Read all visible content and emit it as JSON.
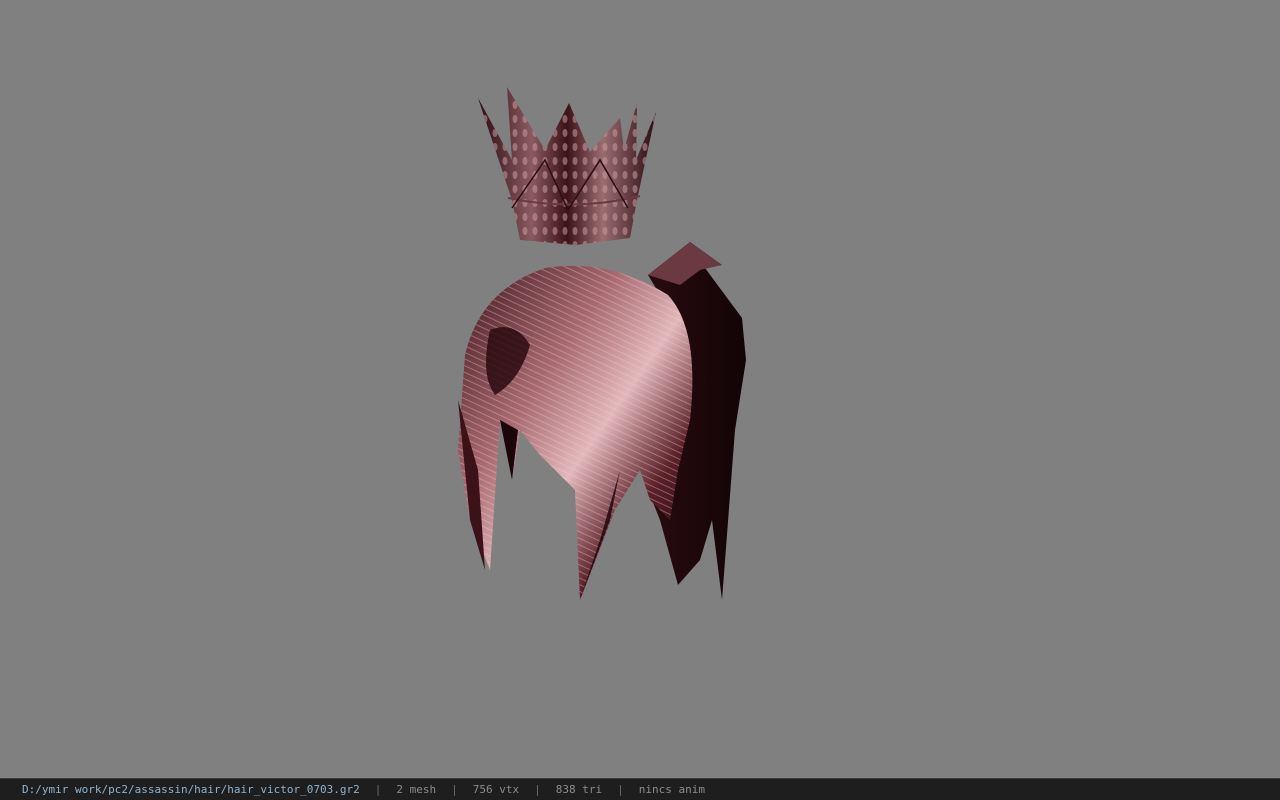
{
  "viewer": {
    "background_color": "#808080",
    "model_hint": "textured-hair-mesh-with-crown",
    "hair_dark_color": "#2a0d12",
    "hair_highlight_color": "#d9a6a9",
    "crown_color": "#5a2a30"
  },
  "statusbar": {
    "file_path": "D:/ymir work/pc2/assassin/hair/hair_victor_0703.gr2",
    "separator": "|",
    "mesh_count": "2 mesh",
    "vertex_count": "756 vtx",
    "triangle_count": "838 tri",
    "anim_status": "nincs anim"
  }
}
